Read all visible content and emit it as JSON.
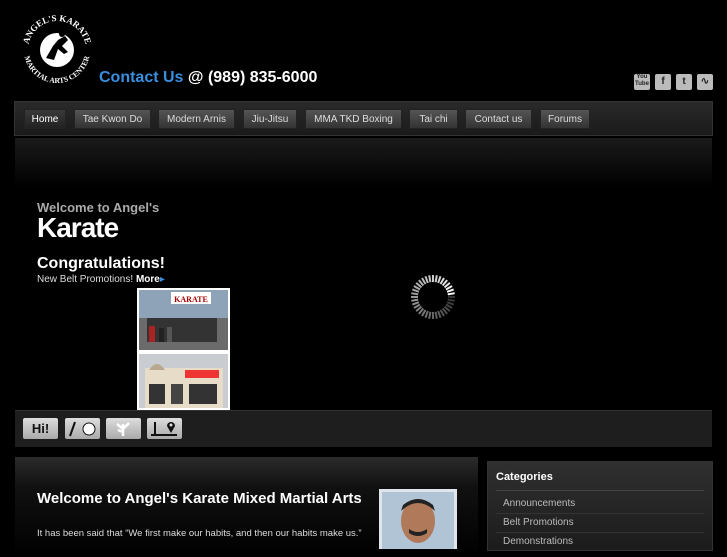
{
  "header": {
    "logo_text_top": "ANGEL'S KARATE",
    "logo_text_bottom": "MARTIAL ARTS CENTER",
    "contact_label": "Contact Us",
    "contact_phone": " @ (989) 835-6000"
  },
  "social": [
    {
      "name": "youtube",
      "label": "You Tube"
    },
    {
      "name": "facebook",
      "label": "f"
    },
    {
      "name": "twitter",
      "label": "t"
    },
    {
      "name": "rss",
      "label": "◔"
    }
  ],
  "nav": [
    "Home",
    "Tae Kwon Do",
    "Modern Arnis",
    "Jiu-Jitsu",
    "MMA TKD Boxing",
    "Tai chi",
    "Contact us",
    "Forums"
  ],
  "hero": {
    "welcome_small": "Welcome to Angel's",
    "welcome_big": "Karate",
    "congrats": "Congratulations!",
    "promo_text": "New Belt Promotions! ",
    "promo_more": "More",
    "sign_text": "KARATE"
  },
  "icons": [
    {
      "name": "hi-icon",
      "label": "Hi!"
    },
    {
      "name": "ball-icon",
      "label": ""
    },
    {
      "name": "leaf-icon",
      "label": ""
    },
    {
      "name": "map-pin-icon",
      "label": ""
    }
  ],
  "content": {
    "title": "Welcome to Angel's Karate Mixed Martial Arts",
    "quote": "It has been said that “We first make our habits, and then our habits make us.”"
  },
  "sidebar": {
    "title": "Categories",
    "items": [
      "Announcements",
      "Belt Promotions",
      "Demonstrations"
    ]
  }
}
